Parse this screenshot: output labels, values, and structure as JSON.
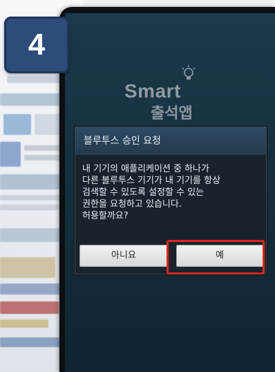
{
  "step": {
    "number": "4"
  },
  "app": {
    "logo_text_en": "Smart",
    "logo_text_kr": "출석앱"
  },
  "dialog": {
    "title": "블루투스 승인 요청",
    "message_lines": [
      "내 기기의 애플리케이션 중 하나가",
      "다른 블루투스 기기가 내 기기를 항상",
      "검색할 수 있도록 설정할 수 있는",
      "권한을 요청하고 있습니다.",
      "허용할까요?"
    ],
    "buttons": {
      "deny_label": "아니요",
      "allow_label": "예"
    }
  },
  "colors": {
    "highlight": "#d8281f",
    "badge": "#2c4c7a",
    "screen": "#1c3a4d"
  }
}
